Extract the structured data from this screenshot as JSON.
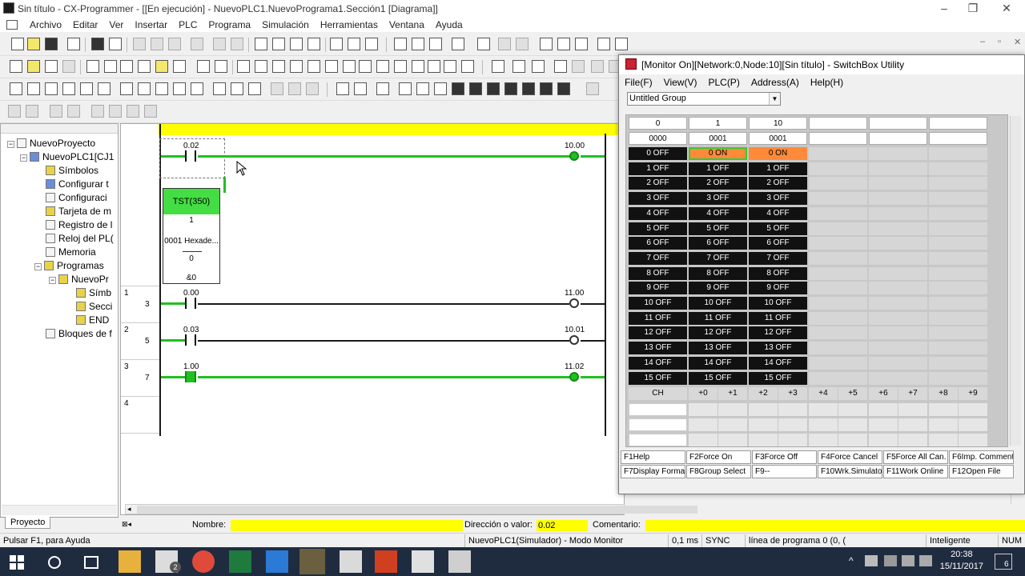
{
  "window": {
    "title": "Sin título - CX-Programmer - [[En ejecución] - NuevoPLC1.NuevoPrograma1.Sección1 [Diagrama]]",
    "controls": [
      "–",
      "❐",
      "✕"
    ]
  },
  "menubar": [
    "Archivo",
    "Editar",
    "Ver",
    "Insertar",
    "PLC",
    "Programa",
    "Simulación",
    "Herramientas",
    "Ventana",
    "Ayuda"
  ],
  "mdi_controls": [
    "–",
    "▫",
    "✕"
  ],
  "project_tree": {
    "tab_label": "Proyecto",
    "nodes": [
      {
        "label": "NuevoProyecto",
        "icon": "project-icon"
      },
      {
        "label": "NuevoPLC1[CJ1",
        "icon": "plc-icon"
      },
      {
        "label": "Símbolos",
        "icon": "symbols-icon"
      },
      {
        "label": "Configurar t",
        "icon": "io-table-icon"
      },
      {
        "label": "Configuraci",
        "icon": "settings-icon"
      },
      {
        "label": "Tarjeta de m",
        "icon": "memory-card-icon"
      },
      {
        "label": "Registro de l",
        "icon": "error-log-icon"
      },
      {
        "label": "Reloj del PL(",
        "icon": "clock-icon"
      },
      {
        "label": "Memoria",
        "icon": "memory-icon"
      },
      {
        "label": "Programas",
        "icon": "programs-icon"
      },
      {
        "label": "NuevoPr",
        "icon": "program-icon"
      },
      {
        "label": "Símb",
        "icon": "symbols-icon"
      },
      {
        "label": "Secci",
        "icon": "section-icon"
      },
      {
        "label": "END",
        "icon": "end-icon"
      },
      {
        "label": "Bloques de f",
        "icon": "function-block-icon"
      }
    ]
  },
  "ladder": {
    "rungs": [
      {
        "rung": "",
        "step": "",
        "contact": "0.02",
        "output": "10.00"
      },
      {
        "rung": "1",
        "step": "3",
        "contact": "0.00",
        "output": "11.00"
      },
      {
        "rung": "2",
        "step": "5",
        "contact": "0.03",
        "output": "10.01"
      },
      {
        "rung": "3",
        "step": "7",
        "contact": "1.00",
        "output": "11.02"
      },
      {
        "rung": "4",
        "step": "",
        "contact": "",
        "output": ""
      }
    ],
    "tst_block": {
      "name": "TST(350)",
      "line1": "1",
      "line2": "0001 Hexade...",
      "line3": "0",
      "line4": "&0"
    }
  },
  "infobar": {
    "nombre_label": "Nombre:",
    "nombre_value": "",
    "direccion_label": "Dirección o valor:",
    "direccion_value": "0.02",
    "comentario_label": "Comentario:",
    "comentario_value": ""
  },
  "statusbar": {
    "help": "Pulsar F1, para Ayuda",
    "plc": "NuevoPLC1(Simulador) - Modo Monitor",
    "cycle": "0,1 ms",
    "sync": "SYNC",
    "line": "línea de programa 0 (0, (",
    "mode": "Inteligente",
    "num": "NUM"
  },
  "switchbox": {
    "title": "[Monitor On][Network:0,Node:10][Sin título] - SwitchBox Utility",
    "menu": [
      "File(F)",
      "View(V)",
      "PLC(P)",
      "Address(A)",
      "Help(H)"
    ],
    "group": "Untitled Group",
    "columns": [
      {
        "channel": "0",
        "value": "0000",
        "on_bits": []
      },
      {
        "channel": "1",
        "value": "0001",
        "on_bits": [
          0
        ]
      },
      {
        "channel": "10",
        "value": "0001",
        "on_bits": [
          0
        ]
      }
    ],
    "off_label": "OFF",
    "on_label": "ON",
    "bit_count": 16,
    "lower_header": [
      "CH",
      "+0",
      "+1",
      "+2",
      "+3",
      "+4",
      "+5",
      "+6",
      "+7",
      "+8",
      "+9"
    ],
    "fkeys": [
      "F1Help",
      "F2Force On",
      "F3Force Off",
      "F4Force Cancel",
      "F5Force All Can.",
      "F6Imp. Comment",
      "F7Display Format",
      "F8Group Select",
      "F9--",
      "F10Wrk.Simulator",
      "F11Work Online",
      "F12Open File"
    ]
  },
  "taskbar": {
    "time": "20:38",
    "date": "15/11/2017",
    "notif_count": "6",
    "mail_badge": "2"
  },
  "colors": {
    "ladder_on": "#20c020",
    "monitor_bar": "#ffff00",
    "bit_on": "#ff8a3a",
    "bit_off": "#111111"
  }
}
